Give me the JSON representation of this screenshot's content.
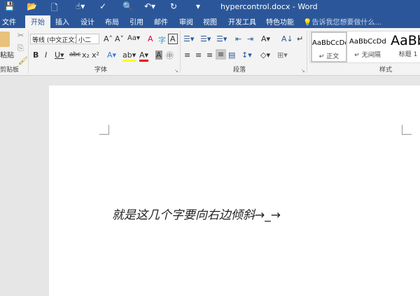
{
  "window": {
    "title": "hypercontrol.docx - Word"
  },
  "tabs": [
    "文件",
    "开始",
    "插入",
    "设计",
    "布局",
    "引用",
    "邮件",
    "审阅",
    "视图",
    "开发工具",
    "特色功能"
  ],
  "tell_me": "告诉我您想要做什么...",
  "clipboard": {
    "paste": "粘贴",
    "group": "剪贴板"
  },
  "font": {
    "name": "等线 (中文正文)",
    "size": "小二",
    "group": "字体"
  },
  "paragraph": {
    "group": "段落"
  },
  "styles": {
    "group": "样式",
    "items": [
      {
        "preview": "AaBbCcDd",
        "name": "↵ 正文"
      },
      {
        "preview": "AaBbCcDd",
        "name": "↵ 无间隔"
      },
      {
        "preview": "AaBb",
        "name": "标题 1"
      }
    ]
  },
  "document": {
    "text": "就是这几个字要向右边倾斜→_→"
  }
}
